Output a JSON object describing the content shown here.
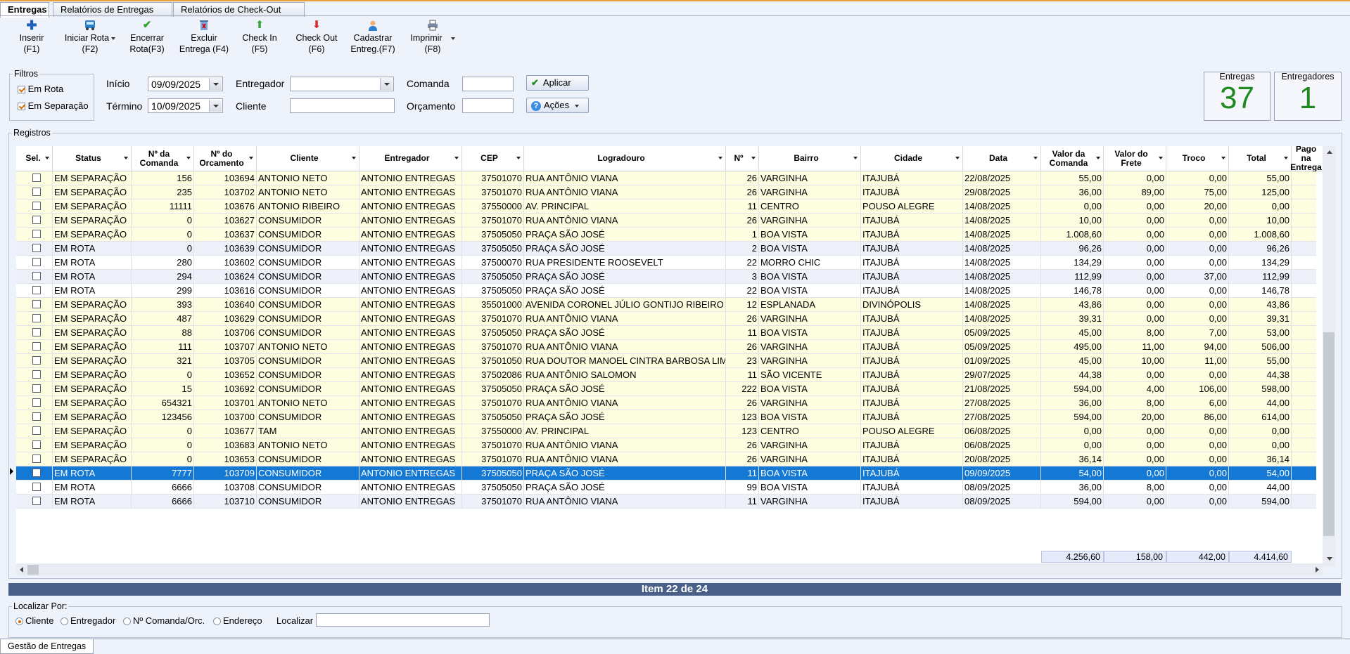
{
  "tabs": [
    {
      "label": "Entregas"
    },
    {
      "label": "Relatórios de Entregas"
    },
    {
      "label": "Relatórios de Check-Out"
    }
  ],
  "toolbar": {
    "inserir": "Inserir",
    "inserir_key": "(F1)",
    "iniciar": "Iniciar Rota",
    "iniciar_key": "(F2)",
    "encerrar": "Encerrar",
    "encerrar_key": "Rota(F3)",
    "excluir": "Excluir",
    "excluir_key": "Entrega (F4)",
    "checkin": "Check In",
    "checkin_key": "(F5)",
    "checkout": "Check Out",
    "checkout_key": "(F6)",
    "cadastrar": "Cadastrar",
    "cadastrar_key": "Entreg.(F7)",
    "imprimir": "Imprimir",
    "imprimir_key": "(F8)"
  },
  "filters": {
    "legend": "Filtros",
    "em_rota": "Em Rota",
    "em_separacao": "Em Separação",
    "inicio_label": "Início",
    "inicio_value": "09/09/2025",
    "termino_label": "Término",
    "termino_value": "10/09/2025",
    "entregador_label": "Entregador",
    "cliente_label": "Cliente",
    "comanda_label": "Comanda",
    "orcamento_label": "Orçamento",
    "aplicar": "Aplicar",
    "acoes": "Ações"
  },
  "counters": {
    "entregas_label": "Entregas",
    "entregas_value": "37",
    "entregadores_label": "Entregadores",
    "entregadores_value": "1"
  },
  "registros_legend": "Registros",
  "columns": [
    "Sel.",
    "Status",
    "Nº da Comanda",
    "Nº do Orcamento",
    "Cliente",
    "Entregador",
    "CEP",
    "Logradouro",
    "Nº",
    "Bairro",
    "Cidade",
    "Data",
    "Valor da Comanda",
    "Valor do Frete",
    "Troco",
    "Total",
    "Pago na Entrega"
  ],
  "rows": [
    [
      "EM SEPARAÇÃO",
      "156",
      "103694",
      "ANTONIO NETO",
      "ANTONIO ENTREGAS",
      "37501070",
      "RUA ANTÔNIO VIANA",
      "26",
      "VARGINHA",
      "ITAJUBÁ",
      "22/08/2025",
      "55,00",
      "0,00",
      "0,00",
      "55,00"
    ],
    [
      "EM SEPARAÇÃO",
      "235",
      "103702",
      "ANTONIO NETO",
      "ANTONIO ENTREGAS",
      "37501070",
      "RUA ANTÔNIO VIANA",
      "26",
      "VARGINHA",
      "ITAJUBÁ",
      "29/08/2025",
      "36,00",
      "89,00",
      "75,00",
      "125,00"
    ],
    [
      "EM SEPARAÇÃO",
      "11111",
      "103676",
      "ANTONIO RIBEIRO",
      "ANTONIO ENTREGAS",
      "37550000",
      "AV. PRINCIPAL",
      "11",
      "CENTRO",
      "POUSO ALEGRE",
      "14/08/2025",
      "0,00",
      "0,00",
      "20,00",
      "0,00"
    ],
    [
      "EM SEPARAÇÃO",
      "0",
      "103627",
      "CONSUMIDOR",
      "ANTONIO ENTREGAS",
      "37501070",
      "RUA ANTÔNIO VIANA",
      "26",
      "VARGINHA",
      "ITAJUBÁ",
      "14/08/2025",
      "10,00",
      "0,00",
      "0,00",
      "10,00"
    ],
    [
      "EM SEPARAÇÃO",
      "0",
      "103637",
      "CONSUMIDOR",
      "ANTONIO ENTREGAS",
      "37505050",
      "PRAÇA SÃO JOSÉ",
      "1",
      "BOA VISTA",
      "ITAJUBÁ",
      "14/08/2025",
      "1.008,60",
      "0,00",
      "0,00",
      "1.008,60"
    ],
    [
      "EM ROTA",
      "0",
      "103639",
      "CONSUMIDOR",
      "ANTONIO ENTREGAS",
      "37505050",
      "PRAÇA SÃO JOSÉ",
      "2",
      "BOA VISTA",
      "ITAJUBÁ",
      "14/08/2025",
      "96,26",
      "0,00",
      "0,00",
      "96,26"
    ],
    [
      "EM ROTA",
      "280",
      "103602",
      "CONSUMIDOR",
      "ANTONIO ENTREGAS",
      "37500070",
      "RUA PRESIDENTE ROOSEVELT",
      "22",
      "MORRO CHIC",
      "ITAJUBÁ",
      "14/08/2025",
      "134,29",
      "0,00",
      "0,00",
      "134,29"
    ],
    [
      "EM ROTA",
      "294",
      "103624",
      "CONSUMIDOR",
      "ANTONIO ENTREGAS",
      "37505050",
      "PRAÇA SÃO JOSÉ",
      "3",
      "BOA VISTA",
      "ITAJUBÁ",
      "14/08/2025",
      "112,99",
      "0,00",
      "37,00",
      "112,99"
    ],
    [
      "EM ROTA",
      "299",
      "103616",
      "CONSUMIDOR",
      "ANTONIO ENTREGAS",
      "37505050",
      "PRAÇA SÃO JOSÉ",
      "22",
      "BOA VISTA",
      "ITAJUBÁ",
      "14/08/2025",
      "146,78",
      "0,00",
      "0,00",
      "146,78"
    ],
    [
      "EM SEPARAÇÃO",
      "393",
      "103640",
      "CONSUMIDOR",
      "ANTONIO ENTREGAS",
      "35501000",
      "AVENIDA CORONEL JÚLIO GONTIJO RIBEIRO",
      "12",
      "ESPLANADA",
      "DIVINÓPOLIS",
      "14/08/2025",
      "43,86",
      "0,00",
      "0,00",
      "43,86"
    ],
    [
      "EM SEPARAÇÃO",
      "487",
      "103629",
      "CONSUMIDOR",
      "ANTONIO ENTREGAS",
      "37501070",
      "RUA ANTÔNIO VIANA",
      "26",
      "VARGINHA",
      "ITAJUBÁ",
      "14/08/2025",
      "39,31",
      "0,00",
      "0,00",
      "39,31"
    ],
    [
      "EM SEPARAÇÃO",
      "88",
      "103706",
      "CONSUMIDOR",
      "ANTONIO ENTREGAS",
      "37505050",
      "PRAÇA SÃO JOSÉ",
      "11",
      "BOA VISTA",
      "ITAJUBÁ",
      "05/09/2025",
      "45,00",
      "8,00",
      "7,00",
      "53,00"
    ],
    [
      "EM SEPARAÇÃO",
      "111",
      "103707",
      "ANTONIO NETO",
      "ANTONIO ENTREGAS",
      "37501070",
      "RUA ANTÔNIO VIANA",
      "26",
      "VARGINHA",
      "ITAJUBÁ",
      "05/09/2025",
      "495,00",
      "11,00",
      "94,00",
      "506,00"
    ],
    [
      "EM SEPARAÇÃO",
      "321",
      "103705",
      "CONSUMIDOR",
      "ANTONIO ENTREGAS",
      "37501050",
      "RUA DOUTOR MANOEL CINTRA BARBOSA LIMA",
      "23",
      "VARGINHA",
      "ITAJUBÁ",
      "01/09/2025",
      "45,00",
      "10,00",
      "11,00",
      "55,00"
    ],
    [
      "EM SEPARAÇÃO",
      "0",
      "103652",
      "CONSUMIDOR",
      "ANTONIO ENTREGAS",
      "37502086",
      "RUA ANTÔNIO SALOMON",
      "11",
      "SÃO VICENTE",
      "ITAJUBÁ",
      "29/07/2025",
      "44,38",
      "0,00",
      "0,00",
      "44,38"
    ],
    [
      "EM SEPARAÇÃO",
      "15",
      "103692",
      "CONSUMIDOR",
      "ANTONIO ENTREGAS",
      "37505050",
      "PRAÇA SÃO JOSÉ",
      "222",
      "BOA VISTA",
      "ITAJUBÁ",
      "21/08/2025",
      "594,00",
      "4,00",
      "106,00",
      "598,00"
    ],
    [
      "EM SEPARAÇÃO",
      "654321",
      "103701",
      "ANTONIO NETO",
      "ANTONIO ENTREGAS",
      "37501070",
      "RUA ANTÔNIO VIANA",
      "26",
      "VARGINHA",
      "ITAJUBÁ",
      "27/08/2025",
      "36,00",
      "8,00",
      "6,00",
      "44,00"
    ],
    [
      "EM SEPARAÇÃO",
      "123456",
      "103700",
      "CONSUMIDOR",
      "ANTONIO ENTREGAS",
      "37505050",
      "PRAÇA SÃO JOSÉ",
      "123",
      "BOA VISTA",
      "ITAJUBÁ",
      "27/08/2025",
      "594,00",
      "20,00",
      "86,00",
      "614,00"
    ],
    [
      "EM SEPARAÇÃO",
      "0",
      "103677",
      "TAM",
      "ANTONIO ENTREGAS",
      "37550000",
      "AV. PRINCIPAL",
      "123",
      "CENTRO",
      "POUSO ALEGRE",
      "06/08/2025",
      "0,00",
      "0,00",
      "0,00",
      "0,00"
    ],
    [
      "EM SEPARAÇÃO",
      "0",
      "103683",
      "ANTONIO NETO",
      "ANTONIO ENTREGAS",
      "37501070",
      "RUA ANTÔNIO VIANA",
      "26",
      "VARGINHA",
      "ITAJUBÁ",
      "06/08/2025",
      "0,00",
      "0,00",
      "0,00",
      "0,00"
    ],
    [
      "EM SEPARAÇÃO",
      "0",
      "103653",
      "CONSUMIDOR",
      "ANTONIO ENTREGAS",
      "37501070",
      "RUA ANTÔNIO VIANA",
      "26",
      "VARGINHA",
      "ITAJUBÁ",
      "20/08/2025",
      "36,14",
      "0,00",
      "0,00",
      "36,14"
    ],
    [
      "EM ROTA",
      "7777",
      "103709",
      "CONSUMIDOR",
      "ANTONIO ENTREGAS",
      "37505050",
      "PRAÇA SÃO JOSÉ",
      "11",
      "BOA VISTA",
      "ITAJUBÁ",
      "09/09/2025",
      "54,00",
      "0,00",
      "0,00",
      "54,00"
    ],
    [
      "EM ROTA",
      "6666",
      "103708",
      "CONSUMIDOR",
      "ANTONIO ENTREGAS",
      "37505050",
      "PRAÇA SÃO JOSÉ",
      "99",
      "BOA VISTA",
      "ITAJUBÁ",
      "08/09/2025",
      "36,00",
      "8,00",
      "0,00",
      "44,00"
    ],
    [
      "EM ROTA",
      "6666",
      "103710",
      "CONSUMIDOR",
      "ANTONIO ENTREGAS",
      "37501070",
      "RUA ANTÔNIO VIANA",
      "11",
      "VARGINHA",
      "ITAJUBÁ",
      "08/09/2025",
      "594,00",
      "0,00",
      "0,00",
      "594,00"
    ]
  ],
  "selected_row_index": 21,
  "totals": {
    "valor_comanda": "4.256,60",
    "valor_frete": "158,00",
    "troco": "442,00",
    "total": "4.414,60"
  },
  "status_bar": "Item 22 de 24",
  "localizar": {
    "legend": "Localizar Por:",
    "cliente": "Cliente",
    "entregador": "Entregador",
    "comanda": "Nº Comanda/Orc.",
    "endereco": "Endereço",
    "label": "Localizar"
  },
  "bottom_tab": "Gestão de Entregas",
  "colors": {
    "accent_tab": "#e8a23a",
    "selected_row": "#1479d5",
    "counter_text": "#1f8a1f",
    "status_bar": "#4a6088"
  }
}
